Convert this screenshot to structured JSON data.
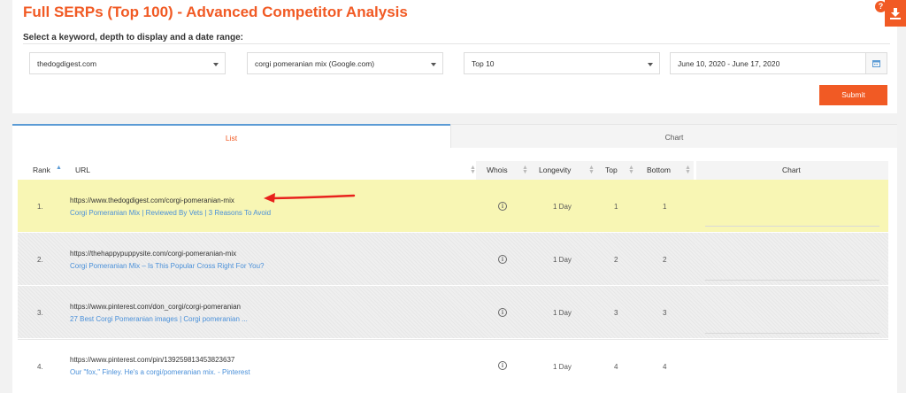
{
  "header": {
    "title": "Full SERPs (Top 100) - Advanced Competitor Analysis",
    "subtitle": "Select a keyword, depth to display and a date range:",
    "help_icon": "question-icon",
    "download_icon": "download-icon"
  },
  "filters": {
    "project": "thedogdigest.com",
    "keyword": "corgi pomeranian mix (Google.com)",
    "depth": "Top 10",
    "date_range": "June 10, 2020 - June 17, 2020",
    "submit_label": "Submit"
  },
  "tabs": [
    {
      "label": "List",
      "active": true
    },
    {
      "label": "Chart",
      "active": false
    }
  ],
  "table": {
    "columns": [
      "Rank",
      "URL",
      "Whois",
      "Longevity",
      "Top",
      "Bottom",
      "Chart"
    ],
    "rows": [
      {
        "rank": "1.",
        "url": "https://www.thedogdigest.com/corgi-pomeranian-mix",
        "title": "Corgi Pomeranian Mix | Reviewed By Vets | 3 Reasons To Avoid",
        "longevity": "1 Day",
        "top": "1",
        "bottom": "1",
        "highlighted": true
      },
      {
        "rank": "2.",
        "url": "https://thehappypuppysite.com/corgi-pomeranian-mix",
        "title": "Corgi Pomeranian Mix – Is This Popular Cross Right For You?",
        "longevity": "1 Day",
        "top": "2",
        "bottom": "2",
        "highlighted": false
      },
      {
        "rank": "3.",
        "url": "https://www.pinterest.com/don_corgi/corgi-pomeranian",
        "title": "27 Best Corgi Pomeranian images | Corgi pomeranian ...",
        "longevity": "1 Day",
        "top": "3",
        "bottom": "3",
        "highlighted": false
      },
      {
        "rank": "4.",
        "url": "https://www.pinterest.com/pin/139259813453823637",
        "title": "Our \"fox,\" Finley. He's a corgi/pomeranian mix. - Pinterest",
        "longevity": "1 Day",
        "top": "4",
        "bottom": "4",
        "highlighted": false
      }
    ]
  },
  "colors": {
    "accent": "#f15a24",
    "highlight_row": "#f8f6b4",
    "link": "#4a90d9",
    "annotation_arrow": "#e8211c"
  }
}
